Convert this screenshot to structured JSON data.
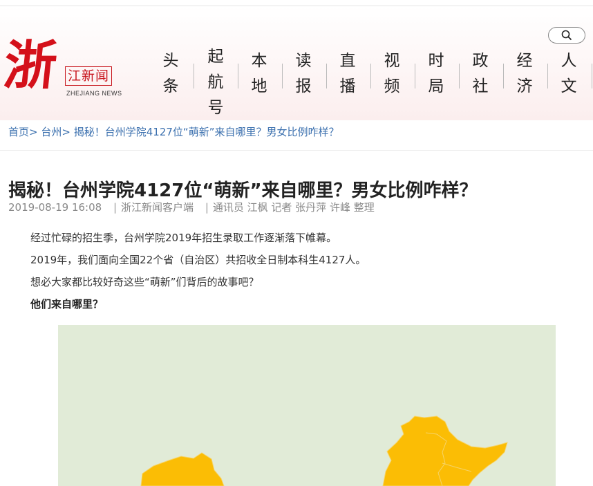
{
  "header": {
    "logo_char": "浙",
    "logo_box": "江新闻",
    "logo_en": "ZHEJIANG NEWS",
    "search_icon": "search-icon",
    "nav": [
      {
        "l1": "头",
        "l2": "条",
        "l3": ""
      },
      {
        "l1": "起",
        "l2": "航",
        "l3": "号"
      },
      {
        "l1": "本",
        "l2": "地",
        "l3": ""
      },
      {
        "l1": "读",
        "l2": "报",
        "l3": ""
      },
      {
        "l1": "直",
        "l2": "播",
        "l3": ""
      },
      {
        "l1": "视",
        "l2": "频",
        "l3": ""
      },
      {
        "l1": "时",
        "l2": "局",
        "l3": ""
      },
      {
        "l1": "政",
        "l2": "社",
        "l3": ""
      },
      {
        "l1": "经",
        "l2": "济",
        "l3": ""
      },
      {
        "l1": "人",
        "l2": "文",
        "l3": ""
      }
    ]
  },
  "breadcrumb": {
    "home": "首页",
    "sep": ">",
    "city": "台州",
    "current": "揭秘！台州学院4127位“萌新”来自哪里？男女比例咋样？"
  },
  "article": {
    "title": "揭秘！台州学院4127位“萌新”来自哪里？男女比例咋样？",
    "date": "2019-08-19 16:08",
    "source": "浙江新闻客户端",
    "authors": "通讯员 江枫 记者 张丹萍 许峰 整理",
    "paragraphs": [
      "经过忙碌的招生季，台州学院2019年招生录取工作逐渐落下帷幕。",
      "2019年，我们面向全国22个省（自治区）共招收全日制本科生4127人。",
      "想必大家都比较好奇这些“萌新”们背后的故事吧？"
    ],
    "subheading": "他们来自哪里？"
  },
  "map": {
    "background": "#e1ebd7",
    "fill": "#fbbd05",
    "border": "#f6d46a"
  }
}
